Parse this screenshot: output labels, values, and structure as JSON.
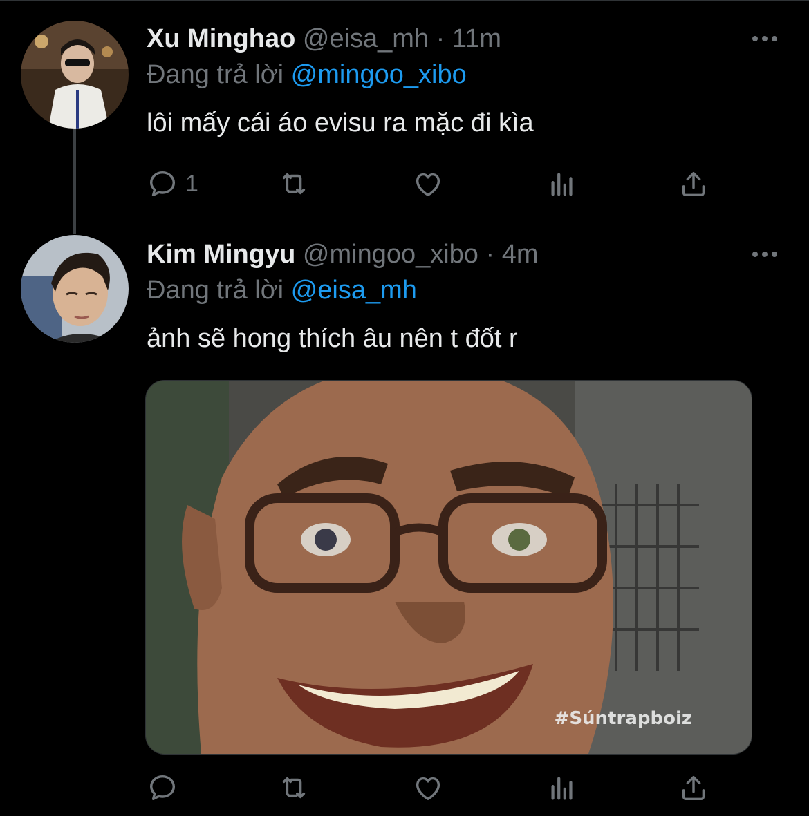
{
  "tweets": [
    {
      "name": "Xu Minghao",
      "handle": "@eisa_mh",
      "separator": "·",
      "time": "11m",
      "replying_prefix": "Đang trả lời",
      "replying_to": "@mingoo_xibo",
      "text": "lôi mấy cái áo evisu ra mặc đi kìa",
      "reply_count": "1"
    },
    {
      "name": "Kim Mingyu",
      "handle": "@mingoo_xibo",
      "separator": "·",
      "time": "4m",
      "replying_prefix": "Đang trả lời",
      "replying_to": "@eisa_mh",
      "text": "ảnh sẽ hong thích âu nên t đốt r",
      "reply_count": "",
      "media_watermark": "#Súntrapboiz"
    }
  ],
  "icons": [
    "reply-icon",
    "retweet-icon",
    "like-icon",
    "analytics-icon",
    "share-icon",
    "more-icon"
  ],
  "colors": {
    "background": "#000000",
    "text": "#e7e9ea",
    "muted": "#71767b",
    "accent": "#1d9bf0"
  }
}
